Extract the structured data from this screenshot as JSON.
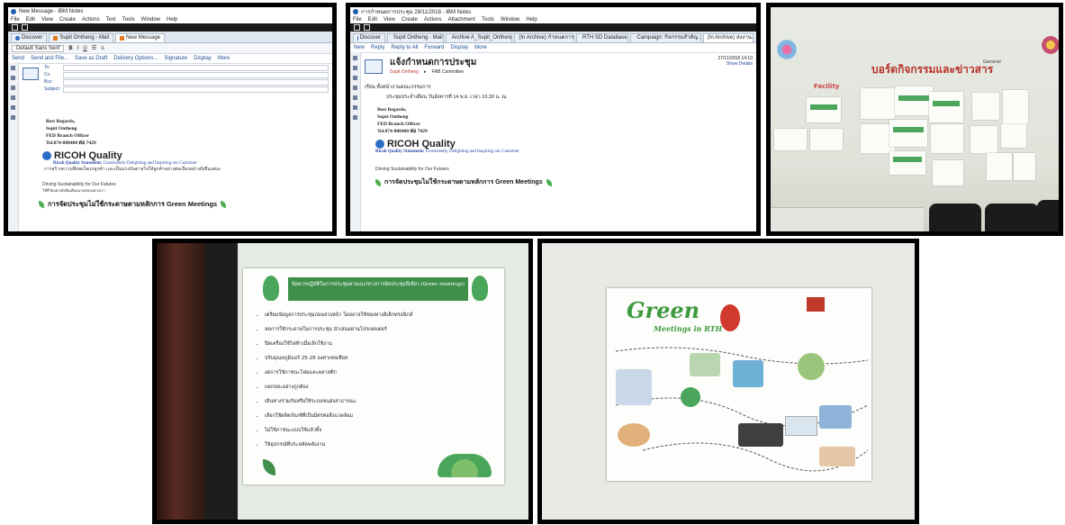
{
  "panel1": {
    "title": "New Message - IBM Notes",
    "menu": [
      "File",
      "Edit",
      "View",
      "Create",
      "Actions",
      "Text",
      "Tools",
      "Window",
      "Help"
    ],
    "tabs": [
      "Discover",
      "Supit Ontheng - Mail",
      "New Message"
    ],
    "font_select": "Default Sans Serif",
    "toolbar_actions": [
      "Send",
      "Send and File...",
      "Save as Draft",
      "Delivery Options...",
      "Signature",
      "Display",
      "More"
    ],
    "fields": [
      "To:",
      "Cc:",
      "Bcc:",
      "Subject:"
    ],
    "signature": {
      "regards": "Best Regards,",
      "name": "Supit Ontheng",
      "role": "FED Branch Officer",
      "tel": "Tel.074-808400 ต่อ 7429"
    },
    "ricoh": "RICOH Quality",
    "statement_label": "Ricoh Quality Statement:",
    "statement_text": "Consistently Delighting and Inspiring our Customer",
    "thai_line": "การสร้างความพึงพอใจแก่ลูกค้า และเป็นแรงบันดาลใจให้ลูกค้าอย่างต่อเนื่องอย่างยั่งยืนเสมอ",
    "sustain": "Driving Sustainability for Our Futures",
    "sustain_thai": "ใช้ชีวิตอย่างยั่งยืนเพื่ออนาคตของพวกเรา",
    "green_line": "การจัดประชุมไม่ใช้กระดาษตามหลักการ Green Meetings"
  },
  "panel2": {
    "title": "การกำหนดการประชุม 28/11/2018 - IBM Notes",
    "menu": [
      "File",
      "Edit",
      "View",
      "Create",
      "Actions",
      "Attachment",
      "Tools",
      "Window",
      "Help"
    ],
    "tabs": [
      "Discover",
      "Supit Ontheng - Mail",
      "Archive A_Supit_Ontheng",
      "(In Archive) กำหนดการ...",
      "RTH SD Database",
      "Campaign: กิจกรรมสำคัญ...",
      "(In Archive) ส่งงาน..."
    ],
    "actions": [
      "New",
      "Reply",
      "Reply to All",
      "Forward",
      "Display",
      "More"
    ],
    "subject": "แจ้งกำหนดการประชุม",
    "sender": "Supit Ontheng",
    "recipient": "FRB Committee",
    "date": "27/11/2018 14:10",
    "show_details": "Show Details",
    "greeting": "เรียน   ทั้งหน้างานคณะกรรมการ",
    "body": "ประชุมประจำเดือน วันอังคารที่ 14 พ.ย. เวลา 10.30 น. ณ",
    "regards": "Best Regards,",
    "name": "Supit Ontheng",
    "role": "FED Branch Officer",
    "tel": "Tel.074-808400 ต่อ 7429",
    "ricoh": "RICOH Quality",
    "statement_label": "Ricoh Quality Statement:",
    "statement_text": "Consistently Delighting and Inspiring our Customer",
    "sustain": "Driving Sustainability for Our Futures",
    "green_line": "การจัดประชุมไม่ใช้กระดาษตามหลักการ Green Meetings"
  },
  "panel3": {
    "board_title": "บอร์ดกิจกรรมและข่าวสาร",
    "facility": "Facility",
    "general": "General"
  },
  "panel4": {
    "heading": "ข้อควรปฏิบัติในการประชุมตามแนวทางการจัดประชุมสีเขียว (Green meetings)",
    "bullets": [
      "เตรียมข้อมูลการประชุมก่อนล่วงหน้า โดยอาจใช้ช่องทางอิเล็กทรอนิกส์",
      "ลดการใช้กระดาษในการประชุม นำเสนอผ่านโปรเจคเตอร์",
      "ปิดเครื่องใช้ไฟฟ้าเมื่อเลิกใช้งาน",
      "ปรับอุณหภูมิแอร์ 25-26 องศาเซลเซียส",
      "งดการใช้ภาชนะโฟมและพลาสติก",
      "แยกขยะอย่างถูกต้อง",
      "เดินทางร่วมกันหรือใช้ระบบขนส่งสาธารณะ",
      "เลือกใช้ผลิตภัณฑ์ที่เป็นมิตรต่อสิ่งแวดล้อม",
      "ไม่ใช้ภาชนะแบบใช้แล้วทิ้ง",
      "ใช้อุปกรณ์ที่ประหยัดพลังงาน"
    ]
  },
  "panel5": {
    "title": "Green",
    "subtitle": "Meetings in RTH"
  }
}
